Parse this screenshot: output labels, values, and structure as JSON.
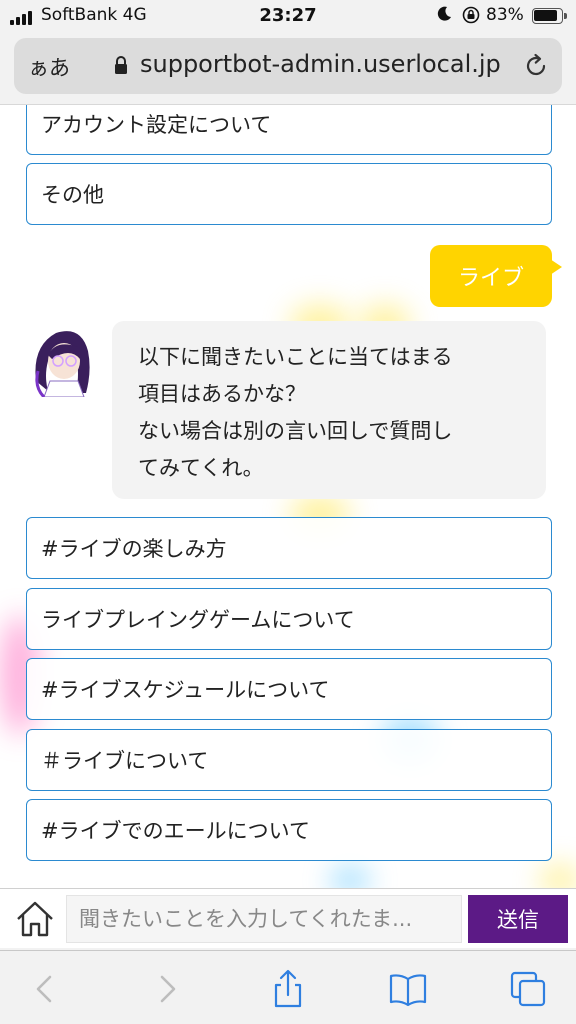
{
  "status_bar": {
    "carrier": "SoftBank 4G",
    "time": "23:27",
    "battery": "83%",
    "battery_level": 0.83
  },
  "browser": {
    "text_size_label": "ぁあ",
    "url": "supportbot-admin.userlocal.jp"
  },
  "chat": {
    "choices_top": [
      "アカウント設定について",
      "その他"
    ],
    "user_message": "ライブ",
    "bot_message_lines": [
      "以下に聞きたいことに当てはまる",
      "項目はあるかな？",
      "ない場合は別の言い回しで質問し",
      "てみてくれ。"
    ],
    "choices_bottom": [
      "#ライブの楽しみ方",
      "ライブプレイングゲームについて",
      "#ライブスケジュールについて",
      "＃ライブについて",
      "#ライブでのエールについて"
    ]
  },
  "input": {
    "placeholder": "聞きたいことを入力してくれたま...",
    "send_label": "送信"
  },
  "colors": {
    "user_bubble": "#ffd400",
    "choice_border": "#2b8ad0",
    "send_button": "#5c1a86"
  },
  "icons": {
    "home": "home-icon",
    "back": "back-arrow-icon",
    "forward": "forward-arrow-icon",
    "share": "share-icon",
    "bookmarks": "bookmarks-icon",
    "tabs": "tabs-icon",
    "reload": "reload-icon",
    "lock": "padlock-icon"
  }
}
